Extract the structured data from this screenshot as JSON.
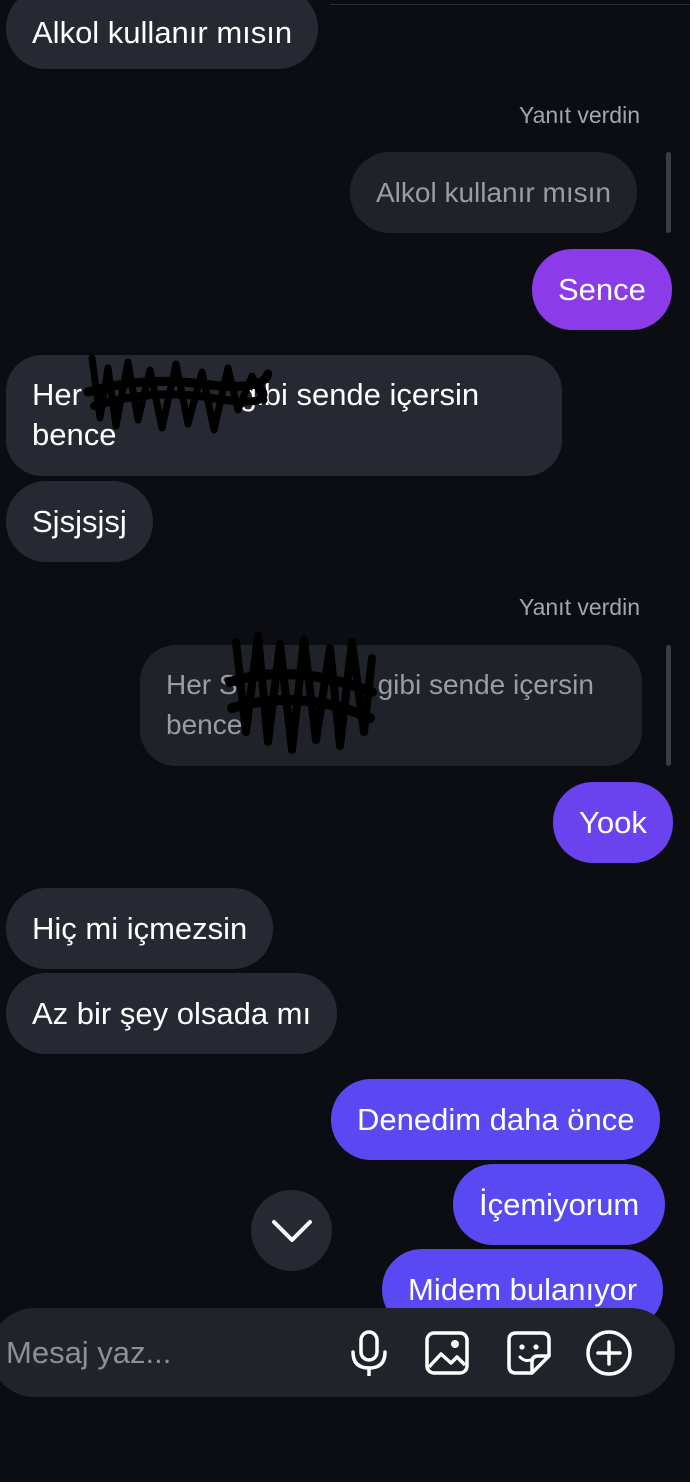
{
  "messages": [
    {
      "text": "Alkol kullanır mısın"
    },
    {
      "reply_label": "Yanıt verdin",
      "quoted": "Alkol kullanır mısın",
      "text": "Sence"
    },
    {
      "text_line1": "Her ",
      "text_line1_rest": "gibi sende içersin",
      "text_line2": "bence"
    },
    {
      "text": "Sjsjsjsj"
    },
    {
      "reply_label": "Yanıt verdin",
      "quoted_line1": "Her S",
      "quoted_line1_rest": "gibi sende içersin",
      "quoted_line2": "bence",
      "text": "Yook"
    },
    {
      "text": "Hiç mi içmezsin"
    },
    {
      "text": "Az bir şey olsada mı"
    },
    {
      "text": "Denedim daha önce"
    },
    {
      "text": "İçemiyorum"
    },
    {
      "text": "Midem bulanıyor"
    }
  ],
  "composer": {
    "placeholder": "Mesaj yaz...",
    "icons": [
      "microphone-icon",
      "gallery-icon",
      "sticker-icon",
      "plus-icon"
    ]
  },
  "scroll_button_icon": "chevron-down-icon",
  "colors": {
    "background": "#0b0d12",
    "received_bubble": "#262931",
    "sent_gradient_top": "#8a3ae8",
    "sent_gradient_bottom": "#5a48f2"
  }
}
